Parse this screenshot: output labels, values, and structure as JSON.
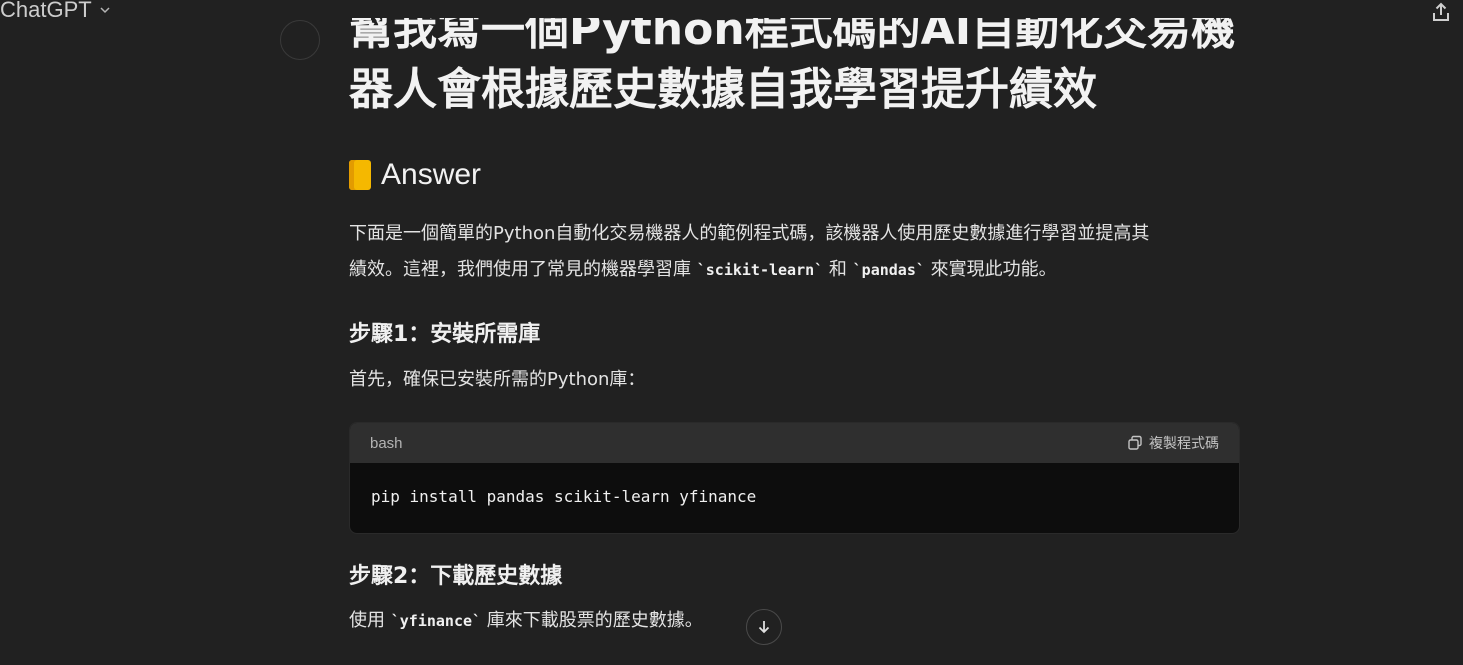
{
  "header": {
    "brand": "ChatGPT"
  },
  "title": {
    "line1": "幫我寫一個Python程式碼的AI自動化交易機",
    "line2": "器人會根據歷史數據自我學習提升績效"
  },
  "answer": {
    "heading": "Answer",
    "intro_part1": "下面是一個簡單的Python自動化交易機器人的範例程式碼，該機器人使用歷史數據進行學習並提高其",
    "intro_part2": "績效。這裡，我們使用了常見的機器學習庫",
    "intro_code1": "`scikit-learn`",
    "intro_mid": "和",
    "intro_code2": "`pandas`",
    "intro_end": "來實現此功能。"
  },
  "step1": {
    "heading": "步驟1：安裝所需庫",
    "text": "首先，確保已安裝所需的Python庫："
  },
  "codeblock": {
    "language": "bash",
    "copy_label": "複製程式碼",
    "code": "pip install pandas scikit-learn yfinance"
  },
  "step2": {
    "heading": "步驟2：下載歷史數據",
    "text_pre": "使用",
    "text_code": "`yfinance`",
    "text_post": "庫來下載股票的歷史數據。"
  },
  "icons": {
    "brand_chevron": "chevron-down-icon",
    "share": "share-icon",
    "copy": "copy-icon",
    "scroll": "arrow-down-icon",
    "answer": "book-icon"
  },
  "colors": {
    "background": "#212121",
    "code_header": "#2f2f2f",
    "code_body": "#0d0d0d",
    "book_icon": "#f5b800"
  }
}
